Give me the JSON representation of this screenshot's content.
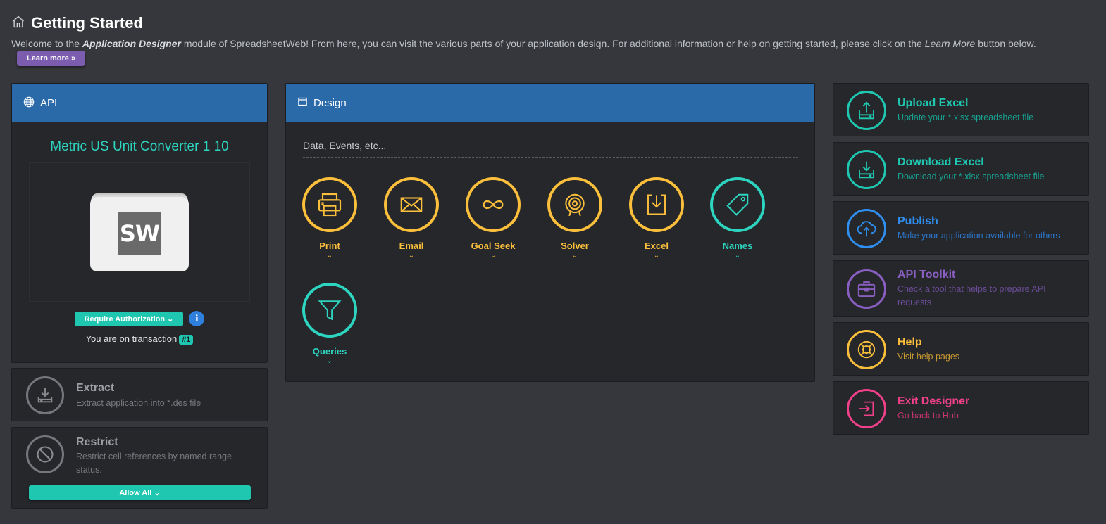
{
  "header": {
    "title": "Getting Started",
    "intro_1": "Welcome to the ",
    "intro_app": "Application Designer",
    "intro_2": " module of SpreadsheetWeb! From here, you can visit the various parts of your application design. For additional information or help on getting started, please click on the ",
    "intro_learn": "Learn More",
    "intro_3": " button below.",
    "learn_more_label": "Learn more »"
  },
  "api": {
    "header": "API",
    "app_name": "Metric US Unit Converter 1 10",
    "logo_text": "SW",
    "auth_label": "Require Authorization",
    "info_glyph": "i",
    "transaction_text": "You are on transaction",
    "transaction_badge": "#1"
  },
  "extract": {
    "title": "Extract",
    "subtitle": "Extract application into *.des file"
  },
  "restrict": {
    "title": "Restrict",
    "subtitle": "Restrict cell references by named range status.",
    "allow_label": "Allow All"
  },
  "design": {
    "header": "Design",
    "search_text": "Data, Events, etc...",
    "items": [
      {
        "label": "Print",
        "icon": "printer-icon"
      },
      {
        "label": "Email",
        "icon": "envelope-icon"
      },
      {
        "label": "Goal Seek",
        "icon": "infinity-icon"
      },
      {
        "label": "Solver",
        "icon": "target-icon"
      },
      {
        "label": "Excel",
        "icon": "download-icon"
      },
      {
        "label": "Names",
        "icon": "tag-icon"
      },
      {
        "label": "Queries",
        "icon": "filter-icon"
      }
    ]
  },
  "actions": [
    {
      "title": "Upload Excel",
      "subtitle": "Update your *.xlsx spreadsheet file",
      "color": "#1fc7b0",
      "icon": "upload-tray-icon"
    },
    {
      "title": "Download Excel",
      "subtitle": "Download your *.xlsx spreadsheet file",
      "color": "#1fc7b0",
      "icon": "download-tray-icon"
    },
    {
      "title": "Publish",
      "subtitle": "Make your application available for others",
      "color": "#2f8ff0",
      "icon": "cloud-upload-icon"
    },
    {
      "title": "API Toolkit",
      "subtitle": "Check a tool that helps to prepare API requests",
      "color": "#8a5fc2",
      "icon": "toolbox-icon"
    },
    {
      "title": "Help",
      "subtitle": "Visit help pages",
      "color": "#fbbf3c",
      "icon": "lifebuoy-icon"
    },
    {
      "title": "Exit Designer",
      "subtitle": "Go back to Hub",
      "color": "#f0408a",
      "icon": "sign-in-icon"
    }
  ],
  "colors": {
    "accent_teal": "#1fc7b0",
    "accent_yellow": "#fbbf3c",
    "header_blue": "#2a6aa8",
    "learn_purple": "#7b5cae"
  }
}
